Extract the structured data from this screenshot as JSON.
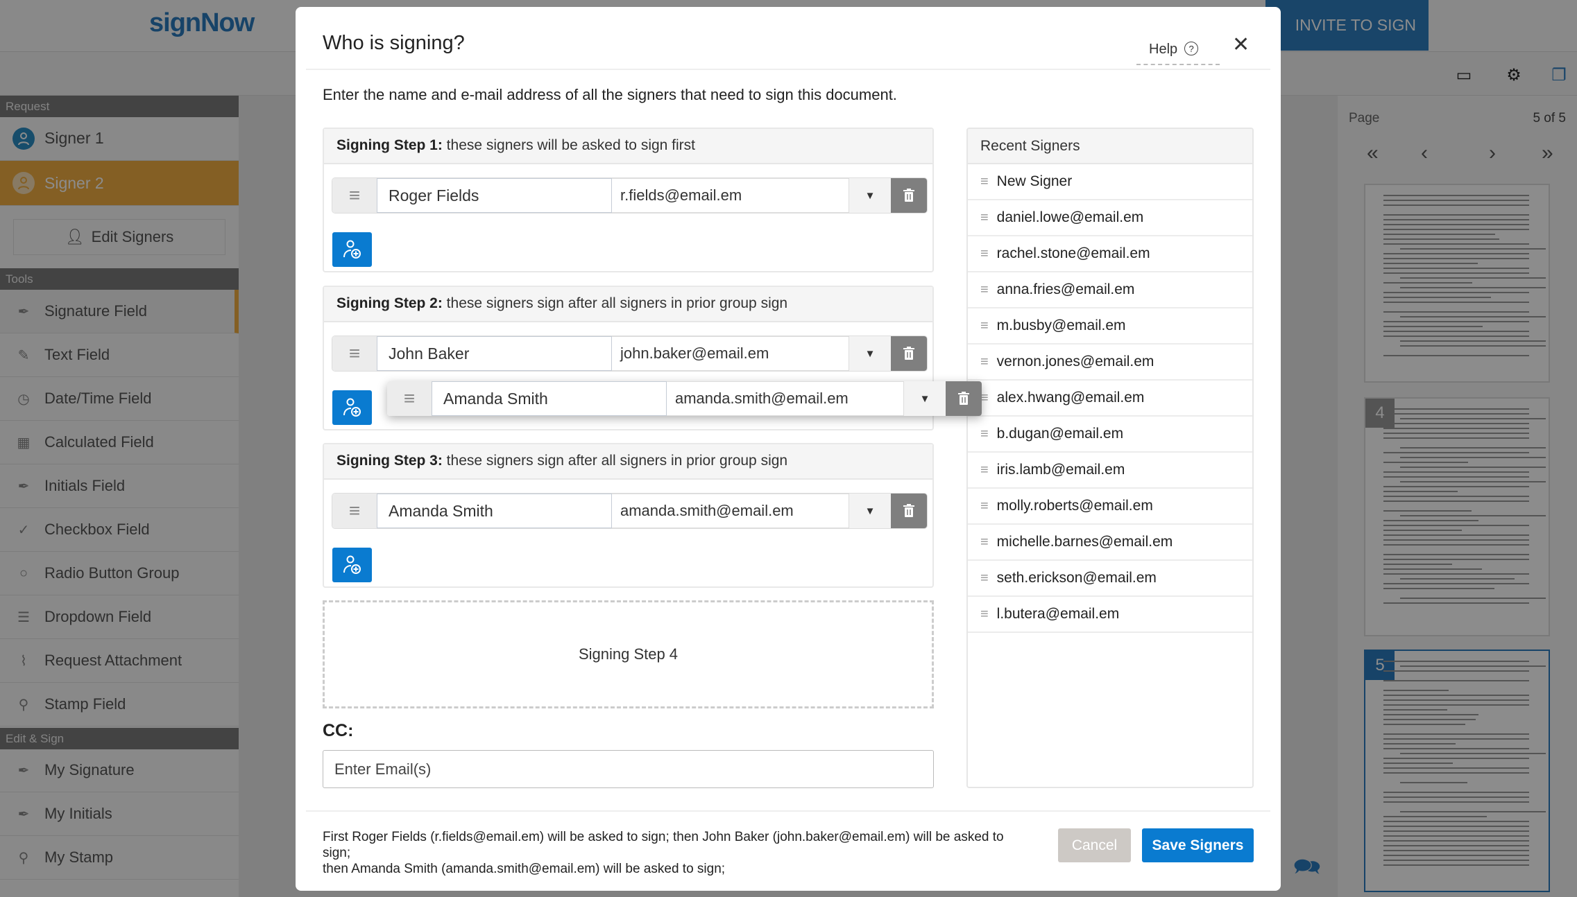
{
  "app": {
    "logo": "signNow",
    "invite_label": "INVITE TO SIGN"
  },
  "sidebar": {
    "request_header": "Request",
    "signers": [
      {
        "label": "Signer 1",
        "color": "#2a8cc4"
      },
      {
        "label": "Signer 2",
        "color": "#f0ad42"
      }
    ],
    "edit_signers": "Edit Signers",
    "tools_header": "Tools",
    "tools": [
      {
        "label": "Signature Field",
        "icon": "pen-nib-icon"
      },
      {
        "label": "Text Field",
        "icon": "pencil-icon"
      },
      {
        "label": "Date/Time Field",
        "icon": "clock-icon"
      },
      {
        "label": "Calculated Field",
        "icon": "calculator-icon"
      },
      {
        "label": "Initials Field",
        "icon": "pen-nib-icon"
      },
      {
        "label": "Checkbox Field",
        "icon": "check-icon"
      },
      {
        "label": "Radio Button Group",
        "icon": "radio-icon"
      },
      {
        "label": "Dropdown Field",
        "icon": "list-icon"
      },
      {
        "label": "Request Attachment",
        "icon": "paperclip-icon"
      },
      {
        "label": "Stamp Field",
        "icon": "stamp-icon"
      }
    ],
    "edit_sign_header": "Edit & Sign",
    "edit_sign": [
      {
        "label": "My Signature",
        "icon": "pen-nib-icon"
      },
      {
        "label": "My Initials",
        "icon": "pen-nib-icon"
      },
      {
        "label": "My Stamp",
        "icon": "stamp-icon"
      }
    ]
  },
  "pages": {
    "label": "Page",
    "current": "5 of 5",
    "thumb_numbers": [
      "4",
      "5"
    ]
  },
  "modal": {
    "title": "Who is signing?",
    "help": "Help",
    "instruction": "Enter the name and e-mail address of all the signers that need to sign this document.",
    "steps": [
      {
        "title": "Signing Step 1:",
        "desc": " these signers will be asked to sign first",
        "signers": [
          {
            "name": "Roger Fields",
            "email": "r.fields@email.em"
          }
        ]
      },
      {
        "title": "Signing Step 2:",
        "desc": " these signers sign after all signers in prior group sign",
        "signers": [
          {
            "name": "John Baker",
            "email": "john.baker@email.em"
          }
        ]
      },
      {
        "title": "Signing Step 3:",
        "desc": " these signers sign after all signers in prior group sign",
        "signers": [
          {
            "name": "Amanda Smith",
            "email": "amanda.smith@email.em"
          }
        ]
      }
    ],
    "dragging": {
      "name": "Amanda Smith",
      "email": "amanda.smith@email.em"
    },
    "empty_step": "Signing Step 4",
    "cc_label": "CC:",
    "cc_placeholder": "Enter Email(s)",
    "recent_title": "Recent Signers",
    "recent": [
      "New Signer",
      "daniel.lowe@email.em",
      "rachel.stone@email.em",
      "anna.fries@email.em",
      "m.busby@email.em",
      "vernon.jones@email.em",
      "alex.hwang@email.em",
      "b.dugan@email.em",
      "iris.lamb@email.em",
      "molly.roberts@email.em",
      "michelle.barnes@email.em",
      "seth.erickson@email.em",
      "l.butera@email.em"
    ],
    "summary_line1": "First Roger Fields (r.fields@email.em) will be asked to sign; then John Baker (john.baker@email.em) will be asked to sign;",
    "summary_line2": "then Amanda Smith (amanda.smith@email.em) will be asked to sign;",
    "cancel": "Cancel",
    "save": "Save Signers",
    "accent": "#0a7bd0"
  }
}
